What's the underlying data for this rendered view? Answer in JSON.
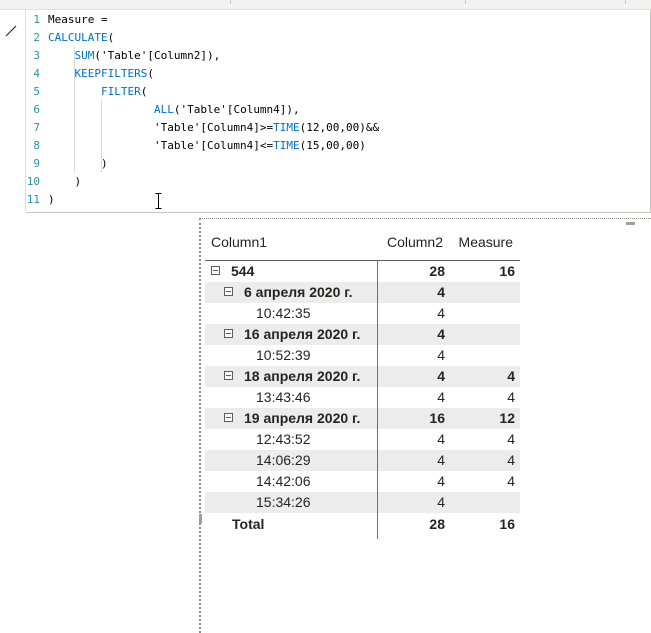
{
  "editor": {
    "lines": [
      {
        "num": "1",
        "parts": [
          {
            "t": "Measure =",
            "k": false
          }
        ]
      },
      {
        "num": "2",
        "parts": [
          {
            "t": "CALCULATE",
            "k": true
          },
          {
            "t": "(",
            "k": false
          }
        ]
      },
      {
        "num": "3",
        "parts": [
          {
            "t": "    ",
            "k": false
          },
          {
            "t": "SUM",
            "k": true
          },
          {
            "t": "('Table'[Column2]),",
            "k": false
          }
        ]
      },
      {
        "num": "4",
        "parts": [
          {
            "t": "    ",
            "k": false
          },
          {
            "t": "KEEPFILTERS",
            "k": true
          },
          {
            "t": "(",
            "k": false
          }
        ]
      },
      {
        "num": "5",
        "parts": [
          {
            "t": "        ",
            "k": false
          },
          {
            "t": "FILTER",
            "k": true
          },
          {
            "t": "(",
            "k": false
          }
        ]
      },
      {
        "num": "6",
        "parts": [
          {
            "t": "                ",
            "k": false
          },
          {
            "t": "ALL",
            "k": true
          },
          {
            "t": "('Table'[Column4]),",
            "k": false
          }
        ]
      },
      {
        "num": "7",
        "parts": [
          {
            "t": "                'Table'[Column4]>=",
            "k": false
          },
          {
            "t": "TIME",
            "k": true
          },
          {
            "t": "(12,00,00)&&",
            "k": false
          }
        ]
      },
      {
        "num": "8",
        "parts": [
          {
            "t": "                'Table'[Column4]<=",
            "k": false
          },
          {
            "t": "TIME",
            "k": true
          },
          {
            "t": "(15,00,00)",
            "k": false
          }
        ]
      },
      {
        "num": "9",
        "parts": [
          {
            "t": "        )",
            "k": false
          }
        ]
      },
      {
        "num": "10",
        "parts": [
          {
            "t": "    )",
            "k": false
          }
        ]
      },
      {
        "num": "11",
        "parts": [
          {
            "t": ")",
            "k": false
          }
        ]
      }
    ]
  },
  "matrix": {
    "headers": {
      "col1": "Column1",
      "col2": "Column2",
      "col3": "Measure"
    },
    "rows": [
      {
        "level": 0,
        "label": "544",
        "c2": "28",
        "c3": "16",
        "bold": true,
        "expander": true,
        "shade": false
      },
      {
        "level": 1,
        "label": "6 апреля 2020 г.",
        "c2": "4",
        "c3": "",
        "bold": true,
        "expander": true,
        "shade": true
      },
      {
        "level": 2,
        "label": "10:42:35",
        "c2": "4",
        "c3": "",
        "bold": false,
        "expander": false,
        "shade": false
      },
      {
        "level": 1,
        "label": "16 апреля 2020 г.",
        "c2": "4",
        "c3": "",
        "bold": true,
        "expander": true,
        "shade": true
      },
      {
        "level": 2,
        "label": "10:52:39",
        "c2": "4",
        "c3": "",
        "bold": false,
        "expander": false,
        "shade": false
      },
      {
        "level": 1,
        "label": "18 апреля 2020 г.",
        "c2": "4",
        "c3": "4",
        "bold": true,
        "expander": true,
        "shade": true
      },
      {
        "level": 2,
        "label": "13:43:46",
        "c2": "4",
        "c3": "4",
        "bold": false,
        "expander": false,
        "shade": false
      },
      {
        "level": 1,
        "label": "19 апреля 2020 г.",
        "c2": "16",
        "c3": "12",
        "bold": true,
        "expander": true,
        "shade": true
      },
      {
        "level": 2,
        "label": "12:43:52",
        "c2": "4",
        "c3": "4",
        "bold": false,
        "expander": false,
        "shade": false
      },
      {
        "level": 2,
        "label": "14:06:29",
        "c2": "4",
        "c3": "4",
        "bold": false,
        "expander": false,
        "shade": true
      },
      {
        "level": 2,
        "label": "14:42:06",
        "c2": "4",
        "c3": "4",
        "bold": false,
        "expander": false,
        "shade": false
      },
      {
        "level": 2,
        "label": "15:34:26",
        "c2": "4",
        "c3": "",
        "bold": false,
        "expander": false,
        "shade": true
      }
    ],
    "total": {
      "label": "Total",
      "c2": "28",
      "c3": "16"
    }
  },
  "colors": {
    "keyword": "#0070c0",
    "line_number": "#2b91af",
    "row_shade": "#ececec",
    "column_separator": "#1e88c8"
  }
}
